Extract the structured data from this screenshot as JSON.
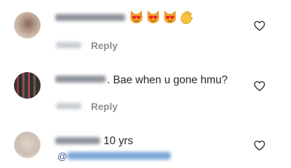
{
  "comments": [
    {
      "emoji": [
        "heart-eyes-cat",
        "heart-eyes-cat",
        "heart-eyes-cat",
        "waving-hand"
      ],
      "reply_label": "Reply",
      "like_icon": "heart-outline-icon"
    },
    {
      "text": ". Bae when u gone hmu?",
      "reply_label": "Reply",
      "like_icon": "heart-outline-icon"
    },
    {
      "text": "10 yrs",
      "mention_prefix": "@",
      "like_icon": "heart-outline-icon"
    }
  ],
  "colors": {
    "text": "#262626",
    "secondary": "#8e8e8e",
    "mention": "#385898"
  }
}
